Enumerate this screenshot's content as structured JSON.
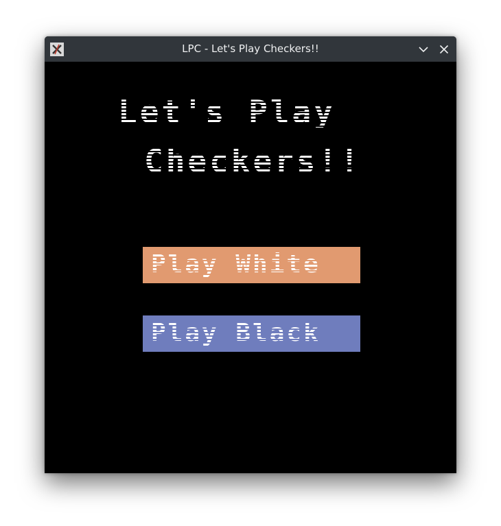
{
  "window": {
    "title": "LPC - Let's Play Checkers!!"
  },
  "titlebar": {
    "app_icon": "x-letter-icon",
    "minimize_icon": "chevron-down-icon",
    "close_icon": "close-icon"
  },
  "main": {
    "heading_line1": "Let's Play",
    "heading_line2": "Checkers!!",
    "buttons": [
      {
        "label": "Play White",
        "color": "#e19a70"
      },
      {
        "label": "Play Black",
        "color": "#6f7dbd"
      }
    ]
  },
  "colors": {
    "titlebar_bg": "#31363b",
    "content_bg": "#000000",
    "text": "#ffffff"
  }
}
